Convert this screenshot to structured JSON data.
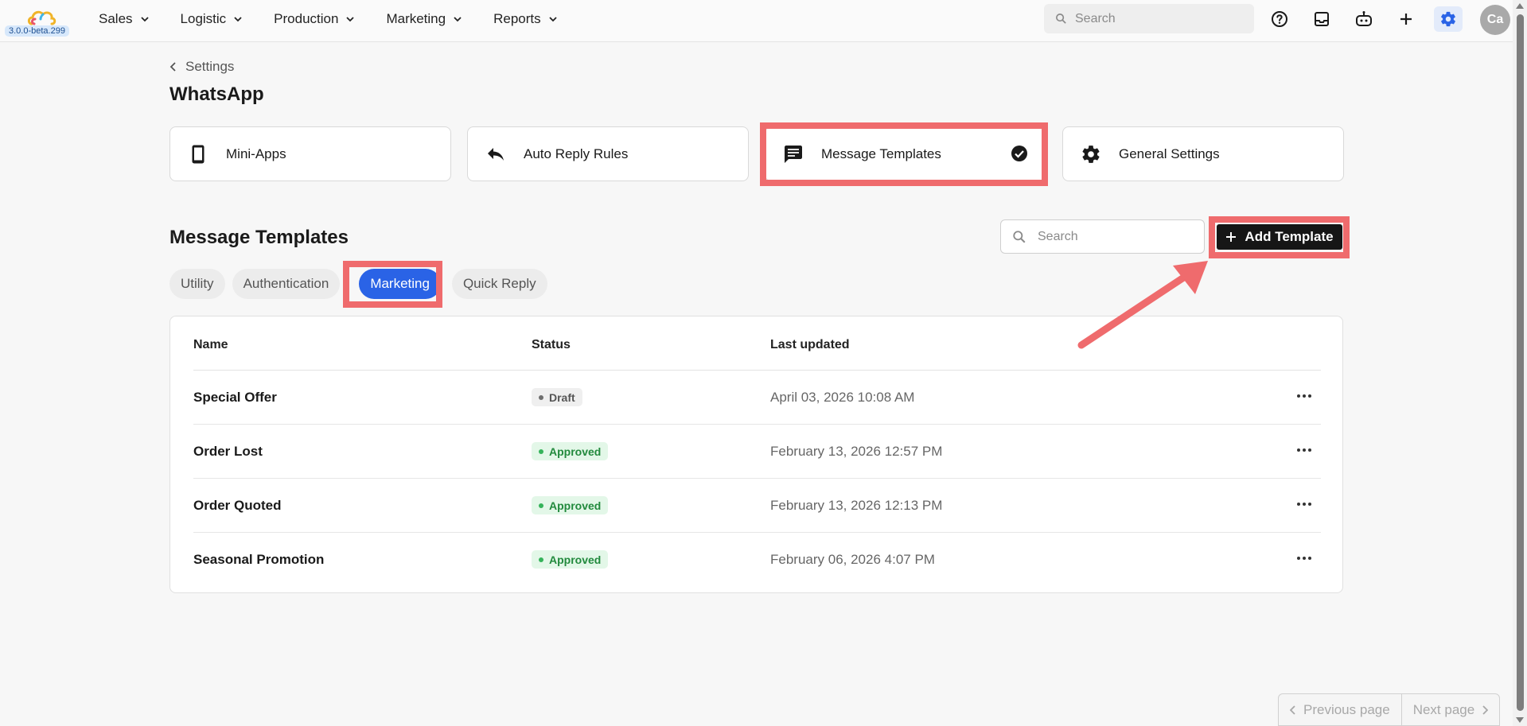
{
  "app": {
    "version": "3.0.0-beta.299"
  },
  "nav": [
    {
      "label": "Sales"
    },
    {
      "label": "Logistic"
    },
    {
      "label": "Production"
    },
    {
      "label": "Marketing"
    },
    {
      "label": "Reports"
    }
  ],
  "topbar": {
    "search_placeholder": "Search",
    "icons": [
      "help-icon",
      "inbox-icon",
      "bot-icon",
      "plus-icon",
      "settings-icon"
    ],
    "avatar_initials": "Ca"
  },
  "breadcrumb": {
    "label": "Settings"
  },
  "page_title": "WhatsApp",
  "cards": [
    {
      "label": "Mini-Apps",
      "icon": "phone-icon"
    },
    {
      "label": "Auto Reply Rules",
      "icon": "reply-icon"
    },
    {
      "label": "Message Templates",
      "icon": "message-icon",
      "selected": true
    },
    {
      "label": "General Settings",
      "icon": "gear-icon"
    }
  ],
  "section": {
    "title": "Message Templates",
    "search_placeholder": "Search",
    "add_label": "Add Template"
  },
  "tabs": [
    {
      "label": "Utility"
    },
    {
      "label": "Authentication"
    },
    {
      "label": "Marketing",
      "active": true
    },
    {
      "label": "Quick Reply"
    }
  ],
  "table": {
    "headers": {
      "name": "Name",
      "status": "Status",
      "updated": "Last updated"
    },
    "rows": [
      {
        "name": "Special Offer",
        "status": "Draft",
        "updated": "April 03, 2026 10:08 AM"
      },
      {
        "name": "Order Lost",
        "status": "Approved",
        "updated": "February 13, 2026 12:57 PM"
      },
      {
        "name": "Order Quoted",
        "status": "Approved",
        "updated": "February 13, 2026 12:13 PM"
      },
      {
        "name": "Seasonal Promotion",
        "status": "Approved",
        "updated": "February 06, 2026 4:07 PM"
      }
    ]
  },
  "pager": {
    "prev_label": "Previous page",
    "next_label": "Next page"
  },
  "colors": {
    "accent": "#2a63e6",
    "highlight": "#ef6b6d",
    "approved": "#228a3d"
  }
}
